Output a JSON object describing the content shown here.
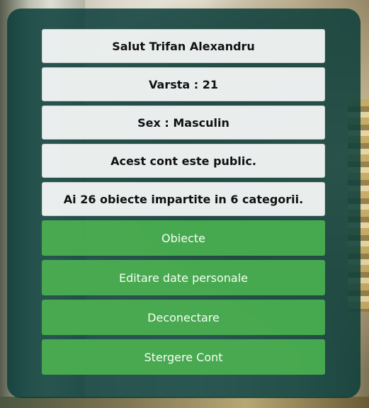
{
  "profile": {
    "greeting": "Salut Trifan Alexandru",
    "age": "Varsta : 21",
    "sex": "Sex : Masculin",
    "visibility": "Acest cont este public.",
    "summary": "Ai 26 obiecte impartite in 6 categorii."
  },
  "actions": {
    "objects": "Obiecte",
    "edit": "Editare date personale",
    "logout": "Deconectare",
    "delete": "Stergere Cont"
  },
  "colors": {
    "panel": "#0a3e3a",
    "button": "#4aae50",
    "info_row": "#ffffff"
  }
}
